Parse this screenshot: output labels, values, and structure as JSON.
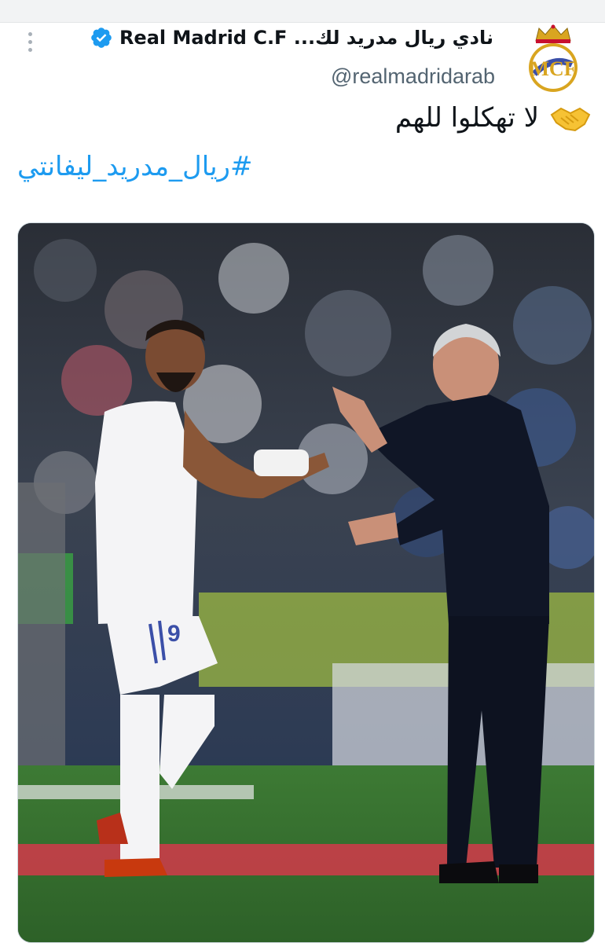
{
  "tweet": {
    "display_name": "نادي ريال مدريد لك... Real Madrid C.F",
    "handle": "@realmadridarab",
    "text": "لا تهكلوا للهم",
    "hashtag": "#ريال_مدريد_ليفانتي",
    "jersey_number": "9"
  },
  "icons": {
    "more": "more-vertical-icon",
    "verified": "verified-badge-icon",
    "handshake": "handshake-emoji-icon",
    "avatar": "real-madrid-crest-icon"
  },
  "colors": {
    "verified_blue": "#1d9bf0",
    "hashtag_blue": "#1d9bf0",
    "text_primary": "#0f1419",
    "text_secondary": "#536471",
    "crest_gold": "#d9a520"
  }
}
